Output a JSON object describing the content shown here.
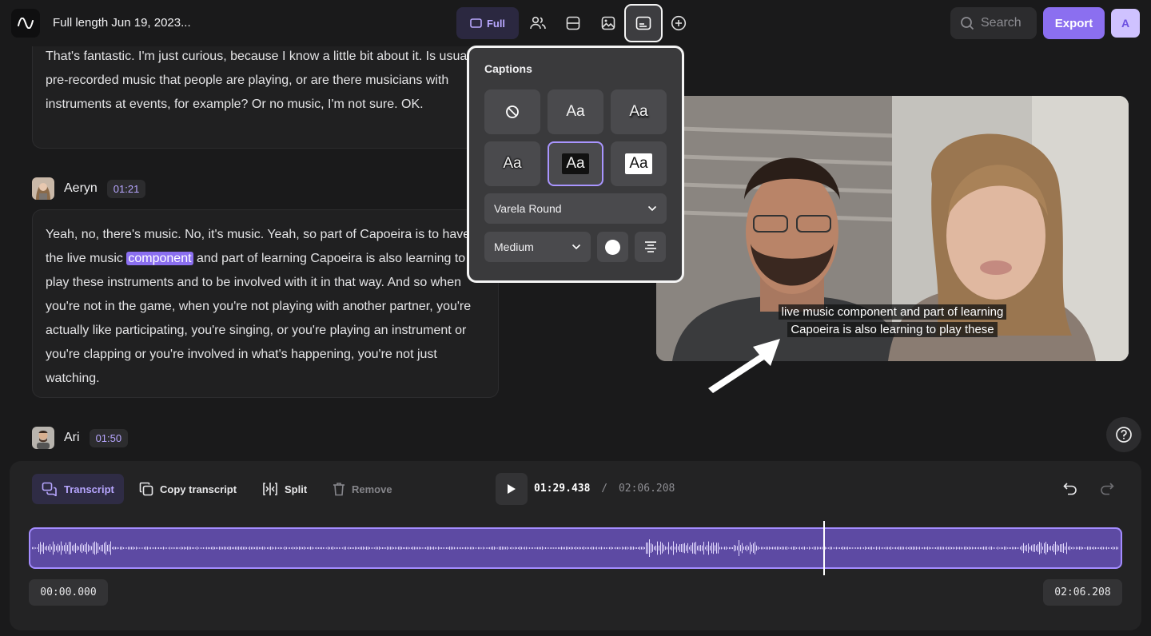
{
  "header": {
    "title": "Full length Jun 19, 2023...",
    "full_label": "Full",
    "search_placeholder": "Search",
    "export_label": "Export",
    "avatar_initial": "A"
  },
  "transcript": {
    "blocks": [
      {
        "text": "That's fantastic. I'm just curious, because I know a little bit about it. Is usually pre-recorded music that people are playing, or are there musicians with instruments at events, for example? Or no music, I'm not sure. OK."
      },
      {
        "speaker": "Aeryn",
        "timestamp": "01:21",
        "text_before": "Yeah, no, there's music. No, it's music. Yeah, so part of Capoeira is to have the live music ",
        "highlight": "component",
        "text_after": " and part of learning Capoeira is also learning to play these instruments and to be involved with it in that way. And so when you're not in the game, when you're not playing with another partner, you're actually like participating, you're singing, or you're playing an instrument or you're clapping or you're involved in what's happening, you're not just watching."
      },
      {
        "speaker": "Ari",
        "timestamp": "01:50"
      }
    ]
  },
  "captions_panel": {
    "title": "Captions",
    "style_sample": "Aa",
    "font": "Varela Round",
    "size": "Medium",
    "selected_color": "#ffffff"
  },
  "video": {
    "caption_line1": "live music component and part of learning",
    "caption_line2": "Capoeira is also learning to play these"
  },
  "toolbar": {
    "transcript_label": "Transcript",
    "copy_label": "Copy transcript",
    "split_label": "Split",
    "remove_label": "Remove",
    "current_time": "01:29.438",
    "separator": "/",
    "total_time": "02:06.208",
    "start_time": "00:00.000",
    "end_time": "02:06.208"
  },
  "colors": {
    "accent": "#8b6ff0",
    "accent_light": "#b7a6ff",
    "background": "#1a1a1b"
  }
}
